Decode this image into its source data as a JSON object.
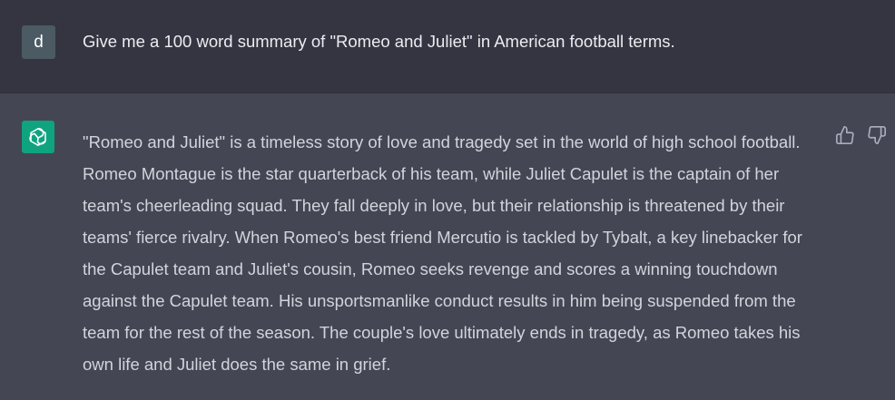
{
  "user_message": {
    "avatar_letter": "d",
    "text": "Give me a 100 word summary of \"Romeo and Juliet\" in American football terms."
  },
  "assistant_message": {
    "avatar_icon": "openai-logo-icon",
    "text": "\"Romeo and Juliet\" is a timeless story of love and tragedy set in the world of high school football. Romeo Montague is the star quarterback of his team, while Juliet Capulet is the captain of her team's cheerleading squad. They fall deeply in love, but their relationship is threatened by their teams' fierce rivalry. When Romeo's best friend Mercutio is tackled by Tybalt, a key linebacker for the Capulet team and Juliet's cousin, Romeo seeks revenge and scores a winning touchdown against the Capulet team. His unsportsmanlike conduct results in him being suspended from the team for the rest of the season. The couple's love ultimately ends in tragedy, as Romeo takes his own life and Juliet does the same in grief."
  },
  "feedback": {
    "thumbs_up_icon": "thumbs-up-icon",
    "thumbs_down_icon": "thumbs-down-icon"
  },
  "colors": {
    "user_bg": "#343541",
    "assistant_bg": "#444654",
    "bot_avatar": "#10a37f",
    "user_avatar": "#4b5a63"
  }
}
